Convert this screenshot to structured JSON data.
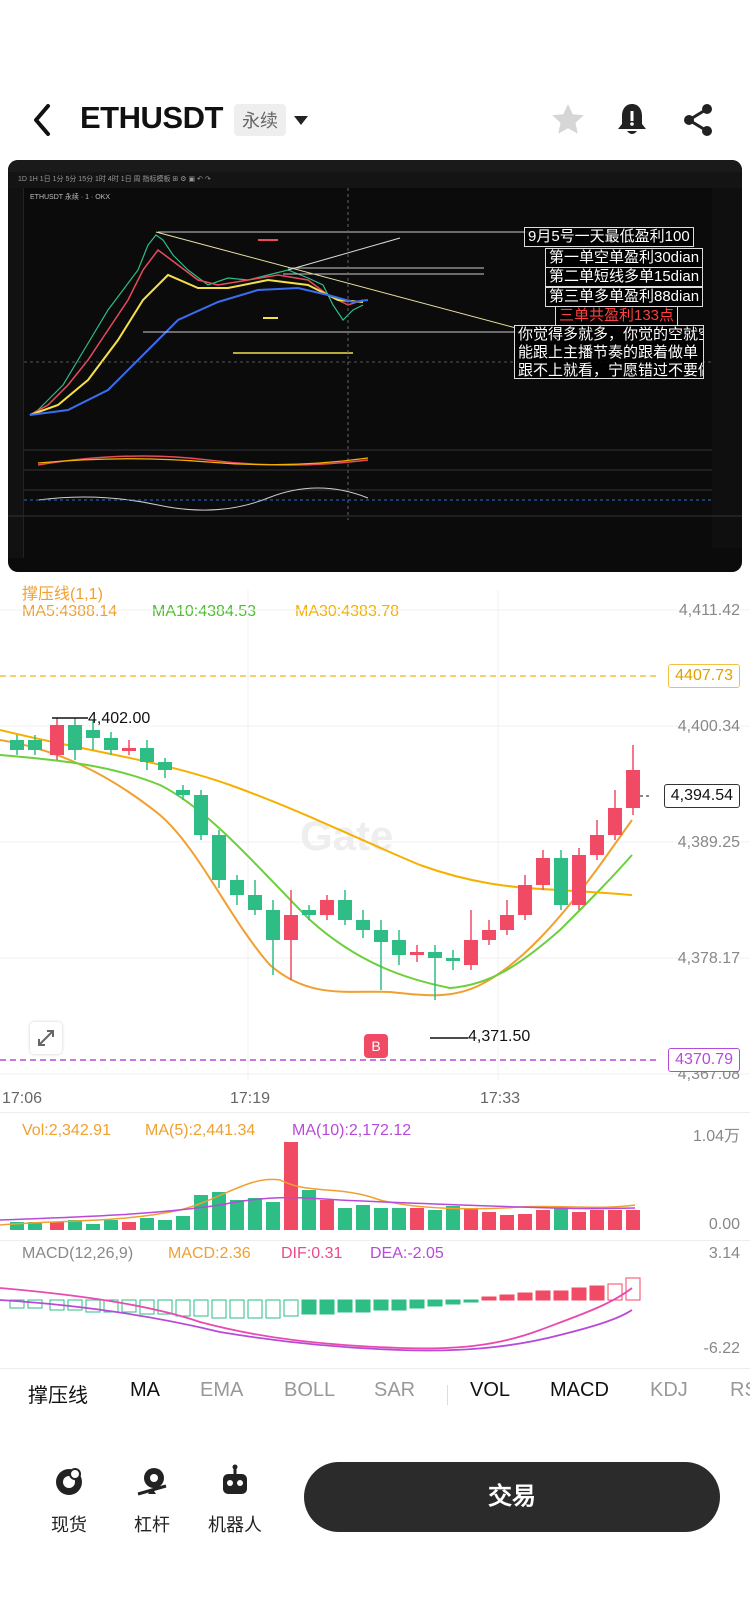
{
  "header": {
    "title": "ETHUSDT",
    "badge": "永续"
  },
  "embed": {
    "toolbar_text": "1D  1H  1日  1分  5分  15分  1时  4时  1日  周  指标模板  ⊞  ⚙  ▣  ↶ ↷",
    "symbol_text": "ETHUSDT 永续 · 1 · OKX",
    "annotations": {
      "line1": "9月5号一天最低盈利100",
      "line2": "第一单空单盈利30dian",
      "line3": "第二单短线多单15dian",
      "line4": "第三单多单盈利88dian",
      "line5": "三单共盈利133点",
      "note1": "你觉得多就多，你觉的空就空",
      "note2": "能跟上主播节奏的跟着做单",
      "note3": "跟不上就看，宁愿错过不要做错"
    }
  },
  "chart": {
    "indicator_title": "撑压线(1,1)",
    "ma5": "MA5:4388.14",
    "ma10": "MA10:4384.53",
    "ma30": "MA30:4383.78",
    "axis": [
      "4,411.42",
      "4,400.34",
      "4,389.25",
      "4,378.17",
      "4,367.08"
    ],
    "resistance": "4407.73",
    "support": "4370.79",
    "current_price": "4,394.54",
    "high_label": "4,402.00",
    "low_label": "4,371.50",
    "buy_marker": "B",
    "watermark": "Gate",
    "times": [
      "17:06",
      "17:19",
      "17:33"
    ],
    "colors": {
      "up": "#f04a64",
      "down": "#2ebd85",
      "ma5": "#f0a030",
      "ma10": "#6ccf3c",
      "ma30": "#f5b000"
    }
  },
  "volume": {
    "vol": "Vol:2,342.91",
    "ma5": "MA(5):2,441.34",
    "ma10": "MA(10):2,172.12",
    "axis_top": "1.04万",
    "axis_bottom": "0.00"
  },
  "macd": {
    "title": "MACD(12,26,9)",
    "macd": "MACD:2.36",
    "dif": "DIF:0.31",
    "dea": "DEA:-2.05",
    "axis_top": "3.14",
    "axis_bottom": "-6.22"
  },
  "tabs": [
    "撑压线",
    "MA",
    "EMA",
    "BOLL",
    "SAR",
    "VOL",
    "MACD",
    "KDJ",
    "RSI"
  ],
  "bottom_nav": {
    "spot": "现货",
    "leverage": "杠杆",
    "robot": "机器人",
    "trade": "交易"
  },
  "chart_data": {
    "type": "candlestick",
    "times": [
      "17:06",
      "17:19",
      "17:33"
    ],
    "ylim": [
      4367.08,
      4411.42
    ],
    "ma_lines": [
      "MA5",
      "MA10",
      "MA30"
    ]
  }
}
